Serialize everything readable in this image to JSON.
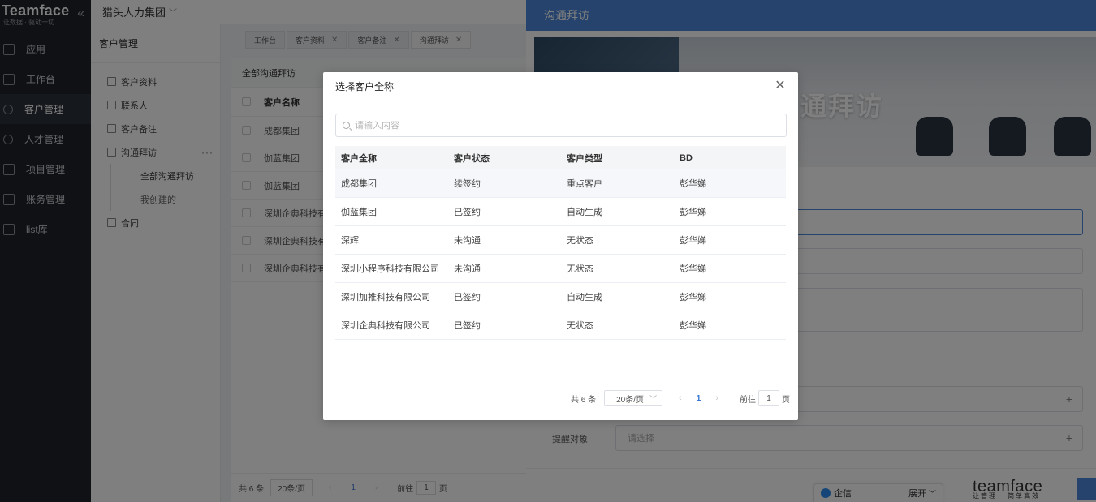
{
  "nav": {
    "brand": "Teamface",
    "slogan": "让数据 · 驱动一切",
    "items": [
      {
        "label": "应用"
      },
      {
        "label": "工作台"
      },
      {
        "label": "客户管理"
      },
      {
        "label": "人才管理"
      },
      {
        "label": "项目管理"
      },
      {
        "label": "账务管理"
      },
      {
        "label": "list库"
      }
    ]
  },
  "topbar": {
    "company": "猎头人力集团"
  },
  "subnav": {
    "head": "客户管理",
    "items": [
      {
        "label": "客户资料"
      },
      {
        "label": "联系人"
      },
      {
        "label": "客户备注"
      },
      {
        "label": "沟通拜访"
      }
    ],
    "children": [
      {
        "label": "全部沟通拜访"
      },
      {
        "label": "我创建的"
      }
    ],
    "last": {
      "label": "合同"
    }
  },
  "tabs": [
    {
      "label": "工作台"
    },
    {
      "label": "客户资料"
    },
    {
      "label": "客户备注"
    },
    {
      "label": "沟通拜访"
    }
  ],
  "main": {
    "title": "全部沟通拜访",
    "col": "客户名称",
    "rows": [
      "成都集团",
      "伽蓝集团",
      "伽蓝集团",
      "深圳企典科技有",
      "深圳企典科技有",
      "深圳企典科技有"
    ],
    "footer": {
      "total": "共 6 条",
      "size": "20条/页",
      "page": "1",
      "goto": "前往",
      "goto_val": "1",
      "unit": "页"
    }
  },
  "drawer": {
    "title": "沟通拜访",
    "banner_text": "通拜访",
    "remind_label": "提醒对象",
    "remind_placeholder": "请选择",
    "brand": "teamface",
    "brand_sub": "让管理 · 简单高效"
  },
  "qixin": {
    "label": "企信",
    "expand": "展开"
  },
  "modal": {
    "title": "选择客户全称",
    "search_placeholder": "请输入内容",
    "columns": [
      "客户全称",
      "客户状态",
      "客户类型",
      "BD"
    ],
    "rows": [
      [
        "成都集团",
        "续签约",
        "重点客户",
        "彭华娣"
      ],
      [
        "伽蓝集团",
        "已签约",
        "自动生成",
        "彭华娣"
      ],
      [
        "深辉",
        "未沟通",
        "无状态",
        "彭华娣"
      ],
      [
        "深圳小程序科技有限公司",
        "未沟通",
        "无状态",
        "彭华娣"
      ],
      [
        "深圳加推科技有限公司",
        "已签约",
        "自动生成",
        "彭华娣"
      ],
      [
        "深圳企典科技有限公司",
        "已签约",
        "无状态",
        "彭华娣"
      ]
    ],
    "pager": {
      "total": "共 6 条",
      "size": "20条/页",
      "page": "1",
      "goto": "前往",
      "goto_val": "1",
      "unit": "页"
    }
  }
}
